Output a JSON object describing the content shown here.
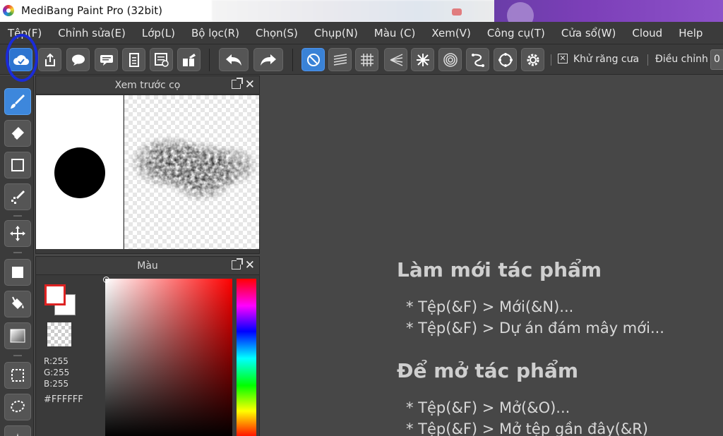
{
  "window": {
    "title": "MediBang Paint Pro (32bit)"
  },
  "menu": [
    "Tệp(F)",
    "Chỉnh sửa(E)",
    "Lớp(L)",
    "Bộ lọc(R)",
    "Chọn(S)",
    "Chụp(N)",
    "Màu (C)",
    "Xem(V)",
    "Công cụ(T)",
    "Cửa sổ(W)",
    "Cloud",
    "Help"
  ],
  "toolbar": {
    "antialias_label": "Khử răng cưa",
    "adjust_label": "Điều chỉnh",
    "adjust_value": "0",
    "antialias_checked_glyph": "✕"
  },
  "panels": {
    "brush_preview": {
      "title": "Xem trước cọ"
    },
    "color": {
      "title": "Màu",
      "r": "R:255",
      "g": "G:255",
      "b": "B:255",
      "hex": "#FFFFFF"
    }
  },
  "welcome": {
    "new_heading": "Làm mới tác phẩm",
    "new_lines": [
      "* Tệp(&F) > Mới(&N)...",
      "* Tệp(&F) > Dự án đám mây mới..."
    ],
    "open_heading": "Để mở tác phẩm",
    "open_lines": [
      "* Tệp(&F) > Mở(&O)...",
      "* Tệp(&F) > Mở tệp gần đây(&R)"
    ]
  },
  "colors": {
    "accent": "#2e75d0",
    "highlight_ring": "#1a2bd8",
    "fg_swatch_border": "#dd2222"
  }
}
